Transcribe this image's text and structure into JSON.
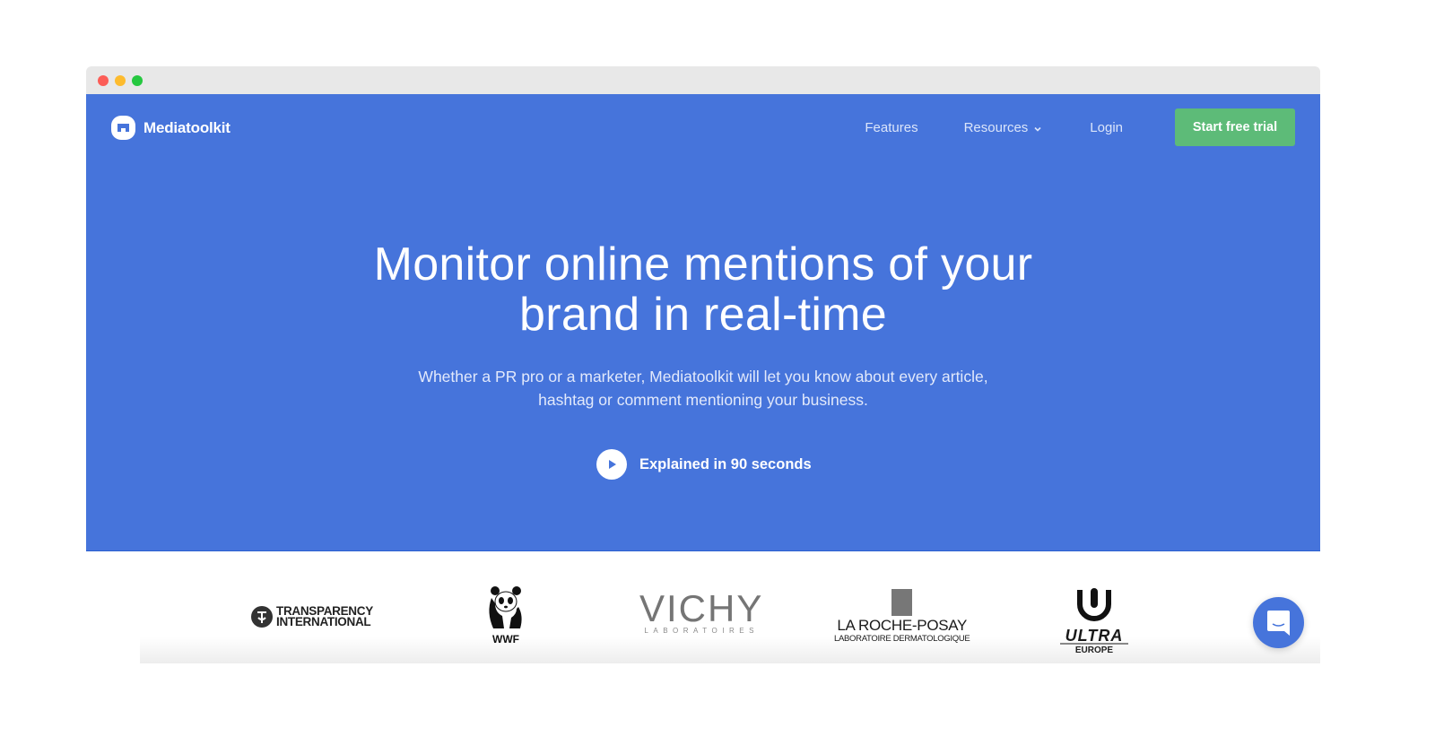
{
  "window": {
    "controls": [
      "close",
      "minimize",
      "maximize"
    ]
  },
  "brand": {
    "name": "Mediatoolkit",
    "logo_icon": "mediatoolkit-logo-icon",
    "accent": "#4674db",
    "cta_color": "#5dbb78"
  },
  "nav": {
    "features": "Features",
    "resources": "Resources",
    "login": "Login",
    "cta": "Start free trial"
  },
  "hero": {
    "headline_line1": "Monitor online mentions of your",
    "headline_line2": "brand in real-time",
    "sub_line1": "Whether a PR pro or a marketer, Mediatoolkit will let you know about every article,",
    "sub_line2": "hashtag or comment mentioning your business.",
    "video_label": "Explained in 90 seconds",
    "video_icon": "play-icon"
  },
  "clients": {
    "transparency": [
      "TRANSPARENCY",
      "INTERNATIONAL"
    ],
    "wwf": "WWF",
    "vichy": [
      "VICHY",
      "LABORATOIRES"
    ],
    "laroche": [
      "LA ROCHE-POSAY",
      "LABORATOIRE DERMATOLOGIQUE"
    ],
    "ultra": [
      "ULTRA",
      "EUROPE"
    ]
  },
  "chat": {
    "icon": "chat-bubble-icon"
  }
}
